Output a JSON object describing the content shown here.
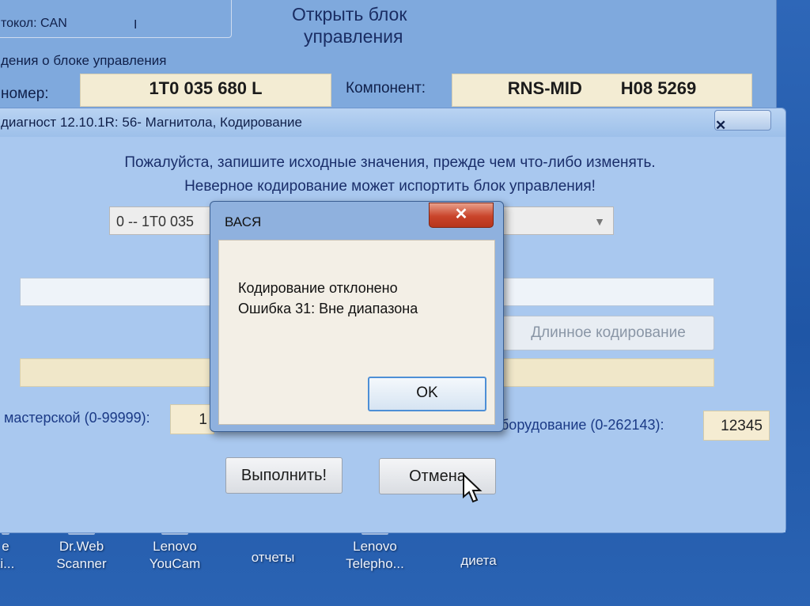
{
  "desktop": {
    "icons": [
      {
        "label_lines": [
          "e",
          "ti..."
        ]
      },
      {
        "label_lines": [
          "Dr.Web",
          "Scanner"
        ]
      },
      {
        "label_lines": [
          "Lenovo",
          "YouCam"
        ]
      },
      {
        "label_lines": [
          "отчеты"
        ]
      },
      {
        "label_lines": [
          "Lenovo",
          "Telepho..."
        ]
      },
      {
        "label_lines": [
          "диета"
        ]
      }
    ]
  },
  "main_window": {
    "protocol_label": "токол: CAN",
    "protocol_mark": "I",
    "open_block_line1": "Открыть блок",
    "open_block_line2": "управления",
    "section_title": "дения о блоке управления",
    "number_label": "номер:",
    "part_number": "1T0 035 680 L",
    "component_label": "Компонент:",
    "component_value": "RNS-MID        H08 5269"
  },
  "coding_dialog": {
    "title": "диагност 12.10.1R: 56- Магнитола,  Кодирование",
    "close_glyph": "✕",
    "warning_line1": "Пожалуйста, запишите исходные значения, прежде чем что-либо изменять.",
    "warning_line2": "Неверное кодирование может испортить блок управления!",
    "combo_value": "0 -- 1T0 035",
    "long_coding_button": "Длинное кодирование",
    "workshop_label": "мастерской (0-99999):",
    "workshop_value": "1",
    "equipment_label": "борудование (0-262143):",
    "equipment_value": "12345",
    "execute_button": "Выполнить!",
    "cancel_button": "Отмена"
  },
  "message_box": {
    "title": "ВАСЯ",
    "close_glyph": "✕",
    "line1": "Кодирование отклонено",
    "line2": "Ошибка 31: Вне диапазона",
    "ok_button": "OK"
  },
  "colors": {
    "desktop_blue": "#1f56a6",
    "dialog_blue": "#a9c8ef",
    "label_blue": "#1b3a86",
    "field_cream": "#f5ecd2",
    "close_red": "#c9442a"
  }
}
